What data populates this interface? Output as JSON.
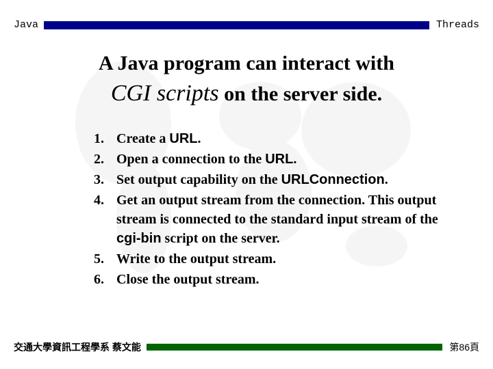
{
  "header": {
    "left": "Java",
    "right": "Threads"
  },
  "title": {
    "line1_a": "A Java program can interact with",
    "cgi": "CGI scripts",
    "line2_b": " on the server side."
  },
  "steps": [
    {
      "num": "1.",
      "parts": [
        {
          "t": "Create a "
        },
        {
          "t": "URL",
          "code": true
        },
        {
          "t": "."
        }
      ]
    },
    {
      "num": "2.",
      "parts": [
        {
          "t": "Open a connection to the "
        },
        {
          "t": "URL",
          "code": true
        },
        {
          "t": "."
        }
      ]
    },
    {
      "num": "3.",
      "parts": [
        {
          "t": "Set output capability on the "
        },
        {
          "t": "URLConnection",
          "code": true
        },
        {
          "t": "."
        }
      ]
    },
    {
      "num": "4.",
      "parts": [
        {
          "t": "Get an output stream from the connection. This output stream is connected to the standard input stream of the "
        },
        {
          "t": "cgi-bin",
          "code": true
        },
        {
          "t": " script on the server."
        }
      ]
    },
    {
      "num": "5.",
      "parts": [
        {
          "t": "Write to the output stream."
        }
      ]
    },
    {
      "num": "6.",
      "parts": [
        {
          "t": "Close the output stream."
        }
      ]
    }
  ],
  "footer": {
    "left": "交通大學資訊工程學系 蔡文能",
    "right": "第86頁"
  }
}
